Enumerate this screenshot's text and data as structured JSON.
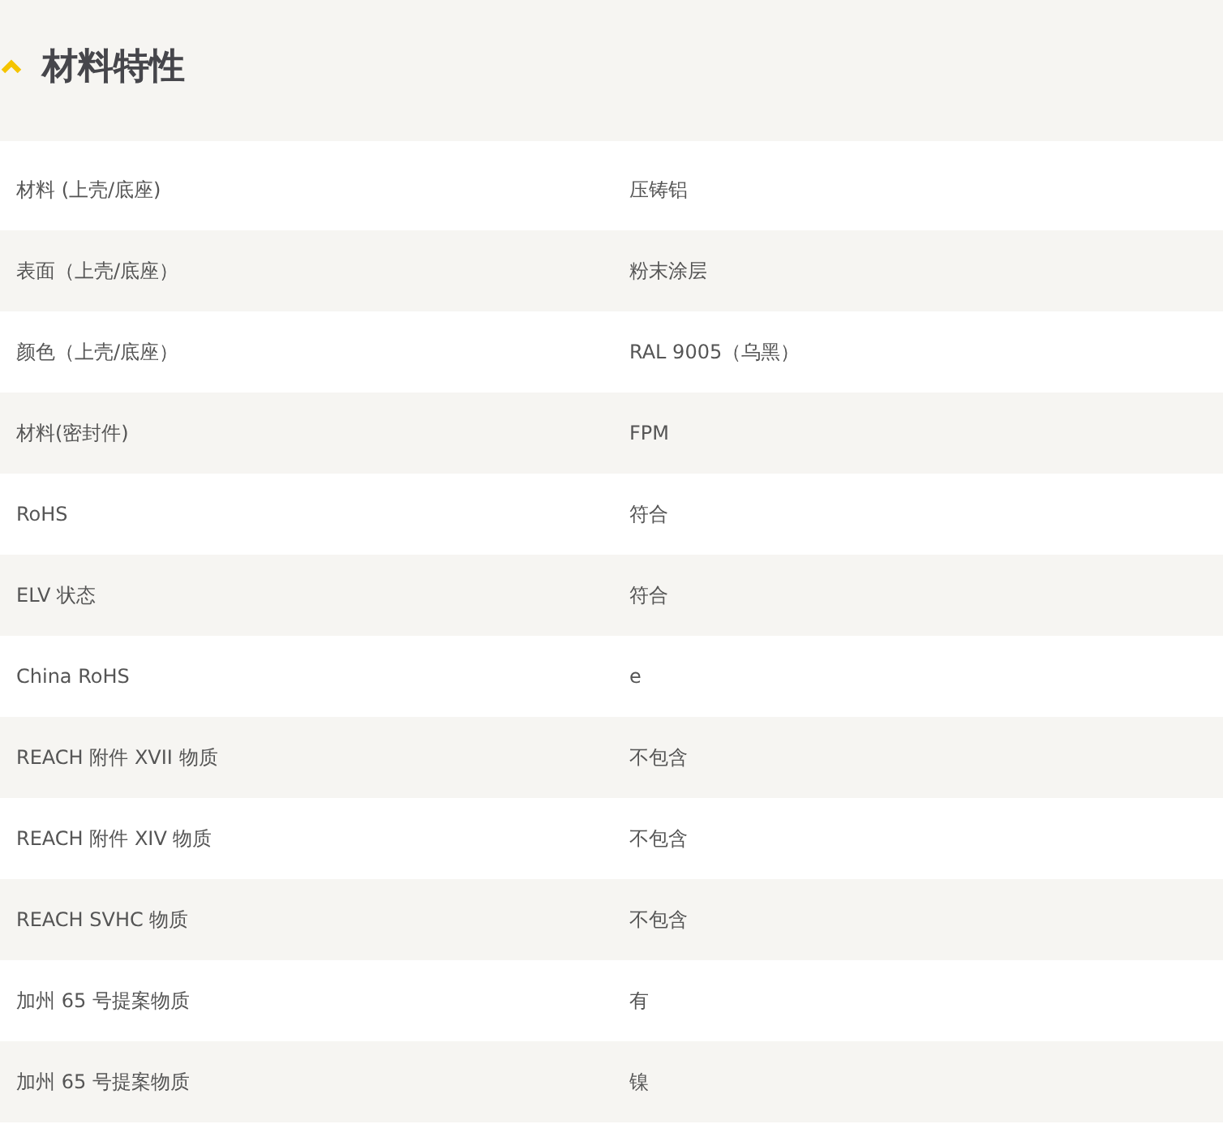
{
  "section": {
    "title": "材料特性",
    "expanded": true
  },
  "rows": [
    {
      "label": "材料 (上壳/底座)",
      "value": "压铸铝"
    },
    {
      "label": "表面（上壳/底座）",
      "value": "粉末涂层"
    },
    {
      "label": "颜色（上壳/底座）",
      "value": "RAL 9005（乌黑）"
    },
    {
      "label": "材料(密封件)",
      "value": "FPM"
    },
    {
      "label": "RoHS",
      "value": "符合"
    },
    {
      "label": "ELV 状态",
      "value": "符合"
    },
    {
      "label": "China RoHS",
      "value": "e"
    },
    {
      "label": "REACH 附件 XVII 物质",
      "value": "不包含"
    },
    {
      "label": "REACH 附件 XIV 物质",
      "value": "不包含"
    },
    {
      "label": "REACH SVHC 物质",
      "value": "不包含"
    },
    {
      "label": "加州 65 号提案物质",
      "value": "有"
    },
    {
      "label": "加州 65 号提案物质",
      "value": "镍"
    }
  ]
}
